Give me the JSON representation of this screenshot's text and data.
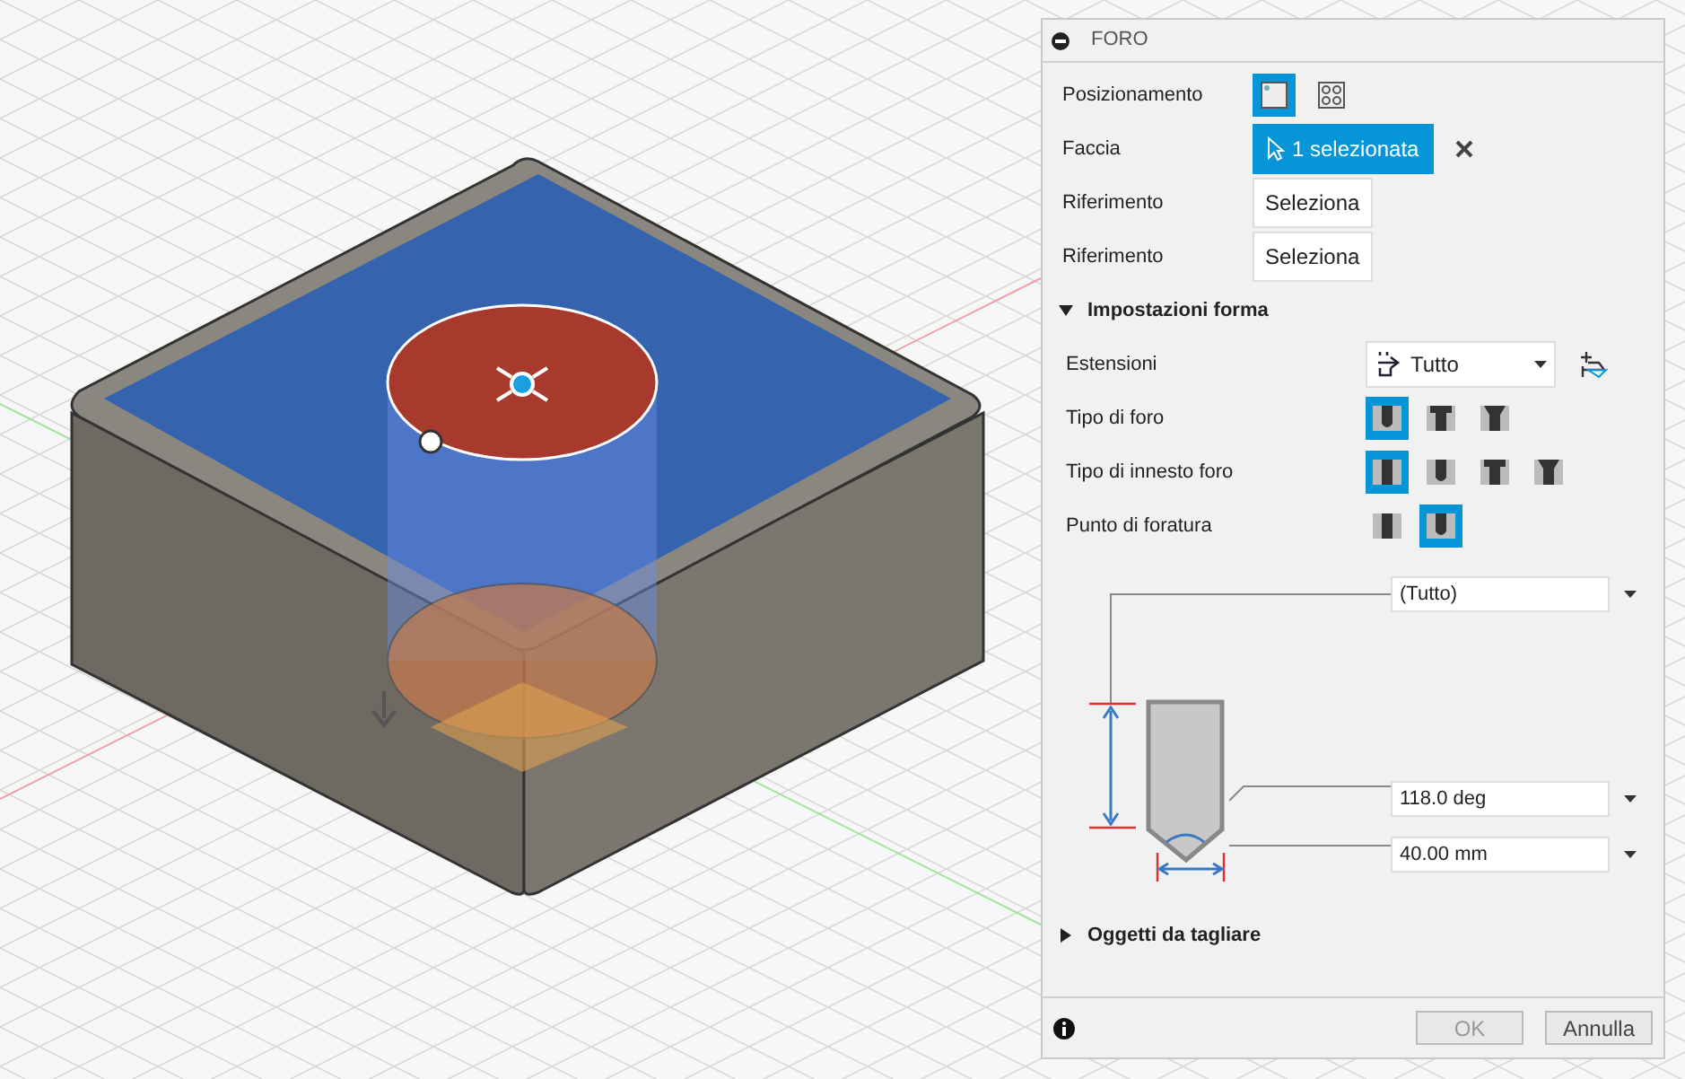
{
  "dialog": {
    "title": "FORO"
  },
  "input_rows": [
    {
      "kind": "icons",
      "label": "Posizionamento",
      "options": [
        {
          "selected": true
        },
        {
          "selected": false
        }
      ]
    },
    {
      "kind": "picked",
      "label": "Faccia",
      "value": "1 selezionata"
    },
    {
      "kind": "select",
      "label": "Riferimento",
      "value": "Seleziona"
    },
    {
      "kind": "select",
      "label": "Riferimento",
      "value": "Seleziona"
    }
  ],
  "shape_section": {
    "title": "Impostazioni forma",
    "expanded": true
  },
  "shape_rows": [
    {
      "kind": "dropdown",
      "label": "Estensioni",
      "value": "Tutto"
    },
    {
      "kind": "icons",
      "label": "Tipo di foro",
      "options": [
        {
          "selected": true
        },
        {
          "selected": false
        },
        {
          "selected": false
        }
      ]
    },
    {
      "kind": "icons",
      "label": "Tipo di innesto foro",
      "options": [
        {
          "selected": true
        },
        {
          "selected": false
        },
        {
          "selected": false
        },
        {
          "selected": false
        }
      ]
    },
    {
      "kind": "icons",
      "label": "Punto di foratura",
      "options": [
        {
          "selected": false
        },
        {
          "selected": true
        }
      ]
    }
  ],
  "diagram_fields": [
    "(Tutto)",
    "118.0 deg",
    "40.00 mm"
  ],
  "objects_section": {
    "title": "Oggetti da tagliare",
    "expanded": false
  },
  "buttons": [
    {
      "label": "OK",
      "disabled": true
    },
    {
      "label": "Annulla",
      "disabled": false
    }
  ]
}
